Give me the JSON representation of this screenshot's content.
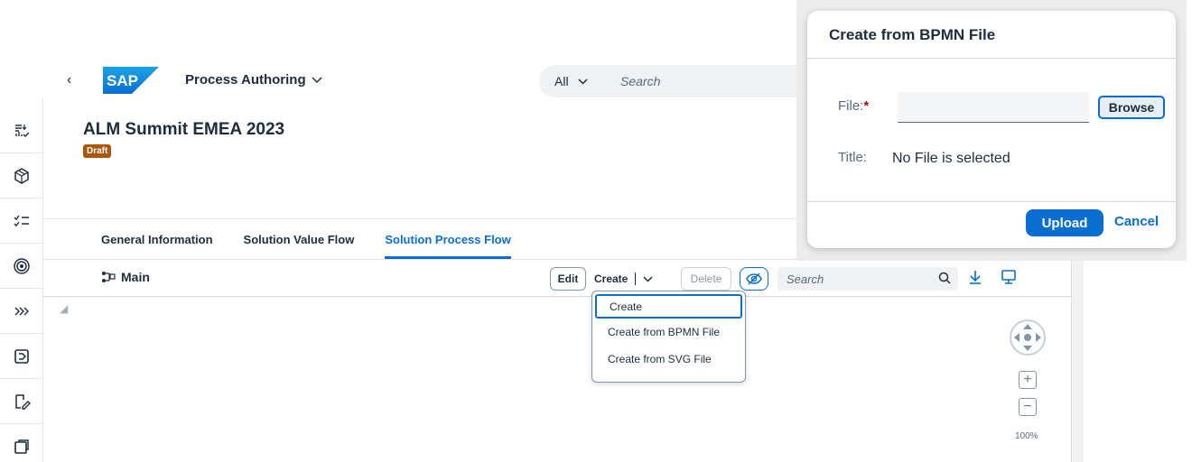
{
  "shell": {
    "app_title": "Process Authoring",
    "search_scope": "All",
    "search_placeholder": "Search",
    "logo_text": "SAP"
  },
  "object": {
    "title": "ALM Summit EMEA 2023",
    "status": "Draft"
  },
  "tabs": [
    {
      "label": "General Information",
      "active": false
    },
    {
      "label": "Solution Value Flow",
      "active": false
    },
    {
      "label": "Solution Process Flow",
      "active": true
    }
  ],
  "toolbar": {
    "diagram_title": "Main",
    "edit_label": "Edit",
    "create_label": "Create",
    "delete_label": "Delete",
    "search_placeholder": "Search"
  },
  "create_menu": {
    "items": [
      "Create",
      "Create from BPMN File",
      "Create from SVG File"
    ],
    "focused_index": 0
  },
  "canvas": {
    "zoom_level": "100%"
  },
  "dialog": {
    "title": "Create from BPMN File",
    "file_label": "File:",
    "file_required_mark": "*",
    "file_value": "",
    "browse_label": "Browse",
    "title_label": "Title:",
    "title_value": "No File is selected",
    "upload_label": "Upload",
    "cancel_label": "Cancel"
  },
  "rail_icons": [
    "requirements-icon",
    "solution-cube-icon",
    "checklist-icon",
    "target-icon",
    "chevrons-right-icon",
    "process-step-icon",
    "edit-document-icon",
    "document-icon"
  ],
  "colors": {
    "accent": "#0a6ed1",
    "draft_badge": "#aa5808",
    "required": "#aa0808"
  }
}
